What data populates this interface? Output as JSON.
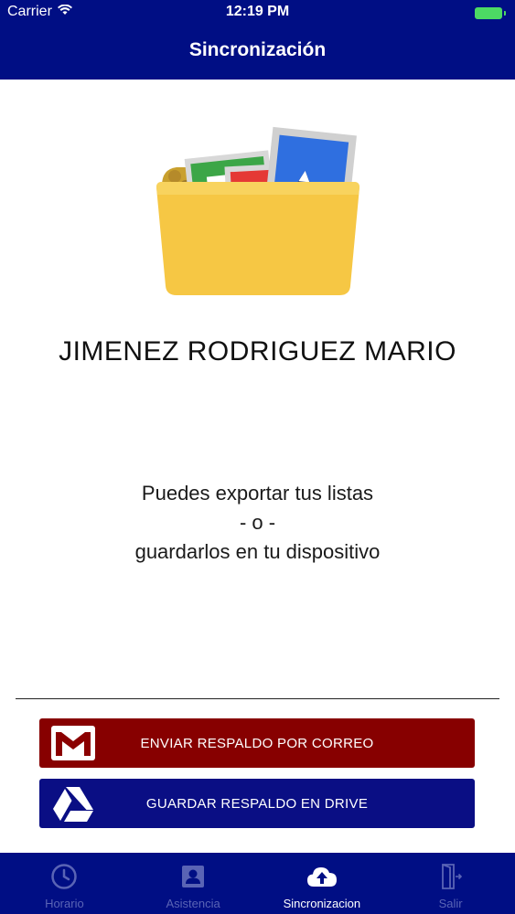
{
  "status_bar": {
    "carrier": "Carrier",
    "time": "12:19 PM"
  },
  "nav": {
    "title": "Sincronización"
  },
  "user": {
    "name": "JIMENEZ RODRIGUEZ MARIO"
  },
  "info": {
    "line1": "Puedes exportar tus listas",
    "line2": "- o -",
    "line3": "guardarlos en tu dispositivo"
  },
  "actions": {
    "mail_label": "ENVIAR RESPALDO POR CORREO",
    "drive_label": "GUARDAR RESPALDO EN DRIVE"
  },
  "tabs": [
    {
      "label": "Horario",
      "icon": "clock-icon",
      "active": false
    },
    {
      "label": "Asistencia",
      "icon": "contact-card-icon",
      "active": false
    },
    {
      "label": "Sincronizacion",
      "icon": "cloud-upload-icon",
      "active": true
    },
    {
      "label": "Salir",
      "icon": "exit-door-icon",
      "active": false
    }
  ],
  "colors": {
    "primary": "#000E84",
    "mail_button": "#870000",
    "drive_button": "#0A0E84",
    "tab_inactive": "#5A64B5",
    "tab_active": "#FFFFFF",
    "folder": "#F6C744"
  }
}
